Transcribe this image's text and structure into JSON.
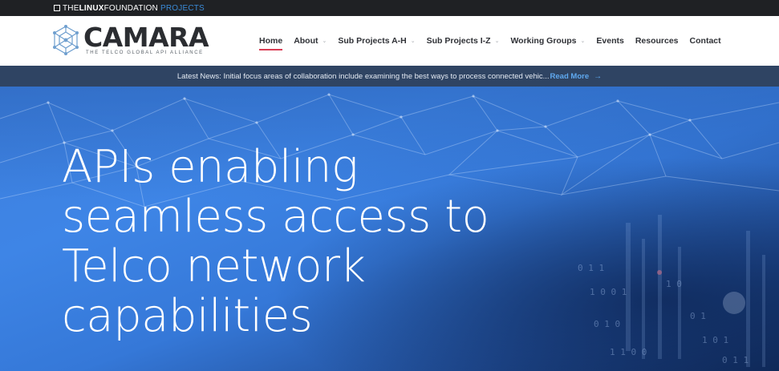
{
  "topbar": {
    "logo_the": "THE",
    "logo_linux": "LINUX",
    "logo_foundation": "FOUNDATION",
    "logo_projects": "PROJECTS"
  },
  "brand": {
    "name": "CAMARA",
    "tagline": "THE TELCO GLOBAL API ALLIANCE"
  },
  "nav": {
    "items": [
      {
        "label": "Home",
        "active": true,
        "has_dropdown": false
      },
      {
        "label": "About",
        "active": false,
        "has_dropdown": true
      },
      {
        "label": "Sub Projects A-H",
        "active": false,
        "has_dropdown": true
      },
      {
        "label": "Sub Projects I-Z",
        "active": false,
        "has_dropdown": true
      },
      {
        "label": "Working Groups",
        "active": false,
        "has_dropdown": true
      },
      {
        "label": "Events",
        "active": false,
        "has_dropdown": false
      },
      {
        "label": "Resources",
        "active": false,
        "has_dropdown": false
      },
      {
        "label": "Contact",
        "active": false,
        "has_dropdown": false
      }
    ],
    "dropdown_icon": "chevron-down-icon"
  },
  "news": {
    "text": "Latest News: Initial focus areas of collaboration include examining the best ways to process connected vehic...",
    "link_label": "Read More",
    "arrow_icon": "arrow-right-icon"
  },
  "hero": {
    "title_lines": [
      "APIs enabling",
      "seamless access to",
      "Telco network",
      "capabilities"
    ]
  },
  "colors": {
    "topbar_bg": "#1f2124",
    "projects_accent": "#3a8ad6",
    "active_underline": "#d93d54",
    "news_bg": "#2f4463",
    "news_link": "#5fa9f0",
    "hero_blue": "#3e85e6"
  }
}
